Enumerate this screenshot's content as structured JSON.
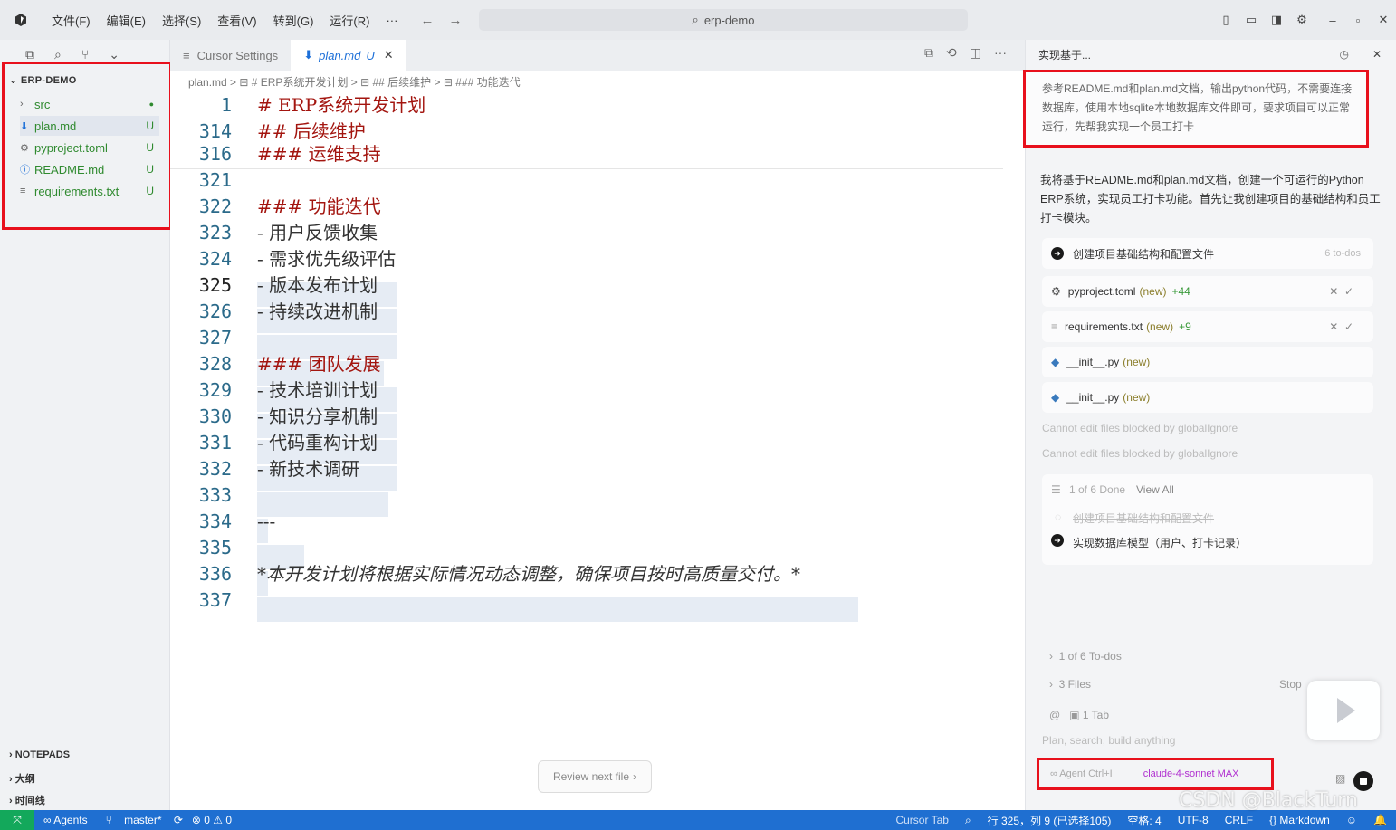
{
  "titlebar": {
    "menus": [
      "文件(F)",
      "编辑(E)",
      "选择(S)",
      "查看(V)",
      "转到(G)",
      "运行(R)",
      "···"
    ],
    "search": "erp-demo"
  },
  "explorer": {
    "root": "ERP-DEMO",
    "items": [
      {
        "name": "src",
        "status": "●"
      },
      {
        "name": "plan.md",
        "status": "U"
      },
      {
        "name": "pyproject.toml",
        "status": "U"
      },
      {
        "name": "README.md",
        "status": "U"
      },
      {
        "name": "requirements.txt",
        "status": "U"
      }
    ],
    "sections": [
      "NOTEPADS",
      "大纲",
      "时间线"
    ]
  },
  "editor": {
    "tabs": [
      {
        "label": "Cursor Settings"
      },
      {
        "label": "plan.md",
        "status": "U"
      }
    ],
    "breadcrumbs": "plan.md > ⊟ # ERP系统开发计划 > ⊟ ## 后续维护 > ⊟ ### 功能迭代",
    "lines": [
      {
        "n": "1",
        "t": "# ERP系统开发计划",
        "h": true
      },
      {
        "n": "314",
        "t": "## 后续维护",
        "h": true
      },
      {
        "n": "316",
        "t": "### 运维支持",
        "h": true
      },
      {
        "n": "321",
        "t": ""
      },
      {
        "n": "322",
        "t": "### 功能迭代",
        "h": true
      },
      {
        "n": "323",
        "t": "- 用户反馈收集"
      },
      {
        "n": "324",
        "t": "- 需求优先级评估"
      },
      {
        "n": "325",
        "t": "- 版本发布计划"
      },
      {
        "n": "326",
        "t": "- 持续改进机制"
      },
      {
        "n": "327",
        "t": ""
      },
      {
        "n": "328",
        "t": "### 团队发展",
        "h": true
      },
      {
        "n": "329",
        "t": "- 技术培训计划"
      },
      {
        "n": "330",
        "t": "- 知识分享机制"
      },
      {
        "n": "331",
        "t": "- 代码重构计划"
      },
      {
        "n": "332",
        "t": "- 新技术调研"
      },
      {
        "n": "333",
        "t": ""
      },
      {
        "n": "334",
        "t": "---"
      },
      {
        "n": "335",
        "t": ""
      },
      {
        "n": "336",
        "t": "*本开发计划将根据实际情况动态调整，确保项目按时高质量交付。*"
      },
      {
        "n": "337",
        "t": ""
      }
    ],
    "review_button": "Review next file"
  },
  "chat": {
    "header": "实现基于...",
    "prompt": "参考README.md和plan.md文档，输出python代码，不需要连接数据库，使用本地sqlite本地数据库文件即可，要求项目可以正常运行，先帮我实现一个员工打卡",
    "reply": "我将基于README.md和plan.md文档，创建一个可运行的Python ERP系统，实现员工打卡功能。首先让我创建项目的基础结构和员工打卡模块。",
    "task": {
      "label": "创建项目基础结构和配置文件",
      "count": "6 to-dos"
    },
    "files": [
      {
        "name": "pyproject.toml",
        "new": "(new)",
        "diff": "+44"
      },
      {
        "name": "requirements.txt",
        "new": "(new)",
        "diff": "+9"
      },
      {
        "name": "__init__.py",
        "new": "(new)",
        "diff": ""
      },
      {
        "name": "__init__.py",
        "new": "(new)",
        "diff": ""
      }
    ],
    "notes": [
      "Cannot edit files blocked by globalIgnore",
      "Cannot edit files blocked by globalIgnore"
    ],
    "todo": {
      "status": "1 of 6 Done",
      "view_all": "View All",
      "done_item": "创建项目基础结构和配置文件",
      "current_item": "实现数据库模型（用户、打卡记录）"
    },
    "summary": [
      "1 of 6 To-dos",
      "3 Files",
      "1 Tab"
    ],
    "stop": "Stop",
    "placeholder": "Plan, search, build anything",
    "agent_label": "∞ Agent Ctrl+I",
    "model": "claude-4-sonnet MAX"
  },
  "statusbar": {
    "agents": "∞ Agents",
    "branch": "master*",
    "problems": "⊗ 0 ⚠ 0",
    "cursor_tab": "Cursor Tab",
    "position": "行 325，列 9 (已选择105)",
    "spaces": "空格: 4",
    "encoding": "UTF-8",
    "eol": "CRLF",
    "language": "{} Markdown"
  },
  "watermark": "CSDN @BlackTurn"
}
